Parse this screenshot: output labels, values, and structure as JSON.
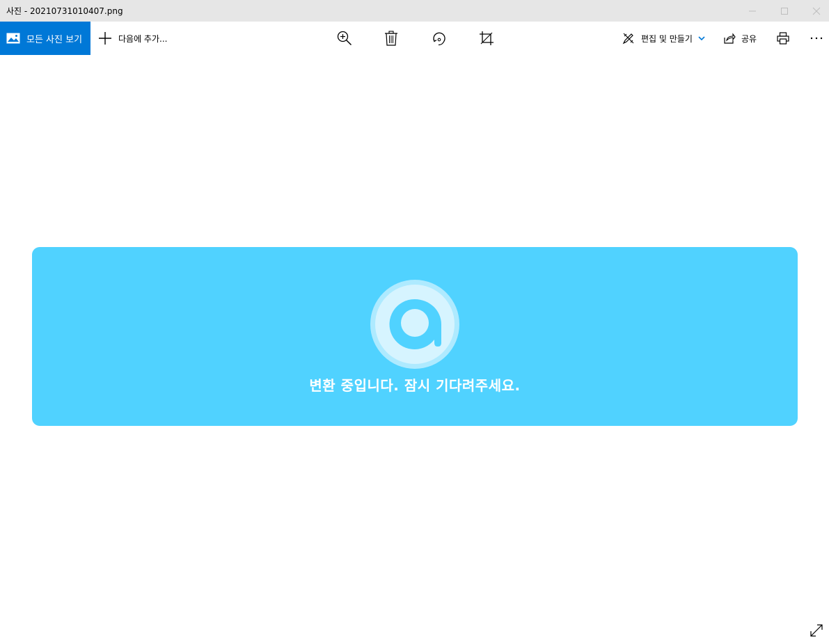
{
  "window": {
    "title": "사진 - 20210731010407.png",
    "minimize_icon": "minimize-icon",
    "maximize_icon": "maximize-icon",
    "close_icon": "close-icon"
  },
  "toolbar": {
    "all_photos_label": "모든 사진 보기",
    "all_photos_icon": "photo-icon",
    "add_to_label": "다음에 추가...",
    "add_icon": "plus-icon",
    "zoom_icon": "zoom-in-icon",
    "delete_icon": "trash-icon",
    "rotate_icon": "rotate-icon",
    "crop_icon": "crop-icon",
    "edit_create_label": "편집 및 만들기",
    "edit_icon": "edit-create-icon",
    "share_label": "공유",
    "share_icon": "share-icon",
    "print_icon": "print-icon",
    "more_icon": "more-icon"
  },
  "image": {
    "message": "변환 중입니다. 잠시 기다려주세요.",
    "logo_icon": "app-logo-icon",
    "fullscreen_icon": "fullscreen-icon"
  },
  "colors": {
    "accent": "#0078d7",
    "titlebar": "#e6e6e6",
    "banner": "#50d2ff"
  }
}
